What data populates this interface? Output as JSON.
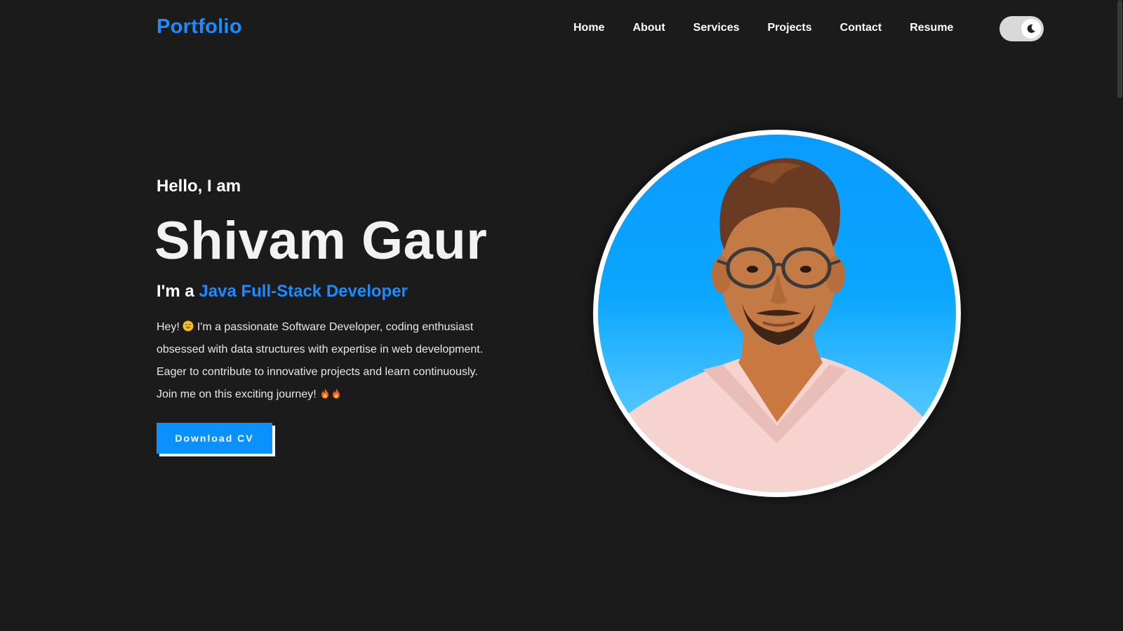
{
  "header": {
    "logo": "Portfolio",
    "nav": [
      "Home",
      "About",
      "Services",
      "Projects",
      "Contact",
      "Resume"
    ],
    "theme_toggle_icon": "moon-icon"
  },
  "hero": {
    "greeting": "Hello, I am",
    "name": "Shivam Gaur",
    "role_prefix": "I'm a",
    "role_title": "Java Full-Stack Developer",
    "bio_line1_a": "Hey!",
    "bio_line1_b": "I'm a passionate Software Developer, coding enthusiast obsessed with data structures with expertise in web development. Eager to contribute to innovative projects and learn continuously. Join me on this exciting journey!",
    "bio_emoji_1": "grinning-face-emoji",
    "bio_emoji_2": "fire-emoji",
    "cv_button": "Download CV",
    "portrait_alt": "profile-photo"
  },
  "colors": {
    "background": "#1b1b1b",
    "accent": "#1a8cff",
    "button": "#0a90ff",
    "text": "#ffffff"
  }
}
